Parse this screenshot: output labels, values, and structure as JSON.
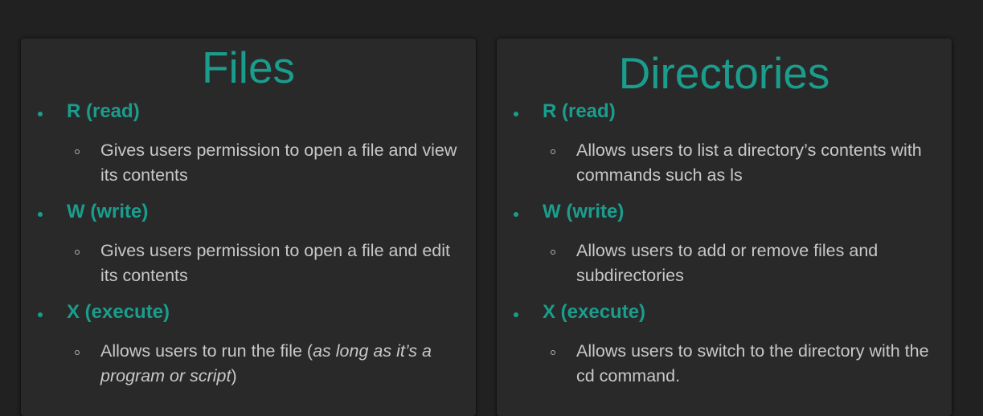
{
  "panels": [
    {
      "title": "Files",
      "items": [
        {
          "label": "R (read)",
          "description": "Gives users permission to open a file and view its contents"
        },
        {
          "label": "W (write)",
          "description": "Gives users permission to open a file and edit its contents"
        },
        {
          "label": "X (execute)",
          "description_prefix": "Allows users to run the file (",
          "description_italic": "as long as it’s a program or script",
          "description_suffix": ")"
        }
      ]
    },
    {
      "title": "Directories",
      "items": [
        {
          "label": "R (read)",
          "description": "Allows users to list a directory’s contents with commands such as ls"
        },
        {
          "label": "W (write)",
          "description": "Allows users to add or remove files and subdirectories"
        },
        {
          "label": "X (execute)",
          "description": "Allows users to switch to the directory with the cd command."
        }
      ]
    }
  ],
  "colors": {
    "accent": "#1a9d8d",
    "background": "#212121",
    "panel": "#292929",
    "text": "#c8c8c8"
  }
}
